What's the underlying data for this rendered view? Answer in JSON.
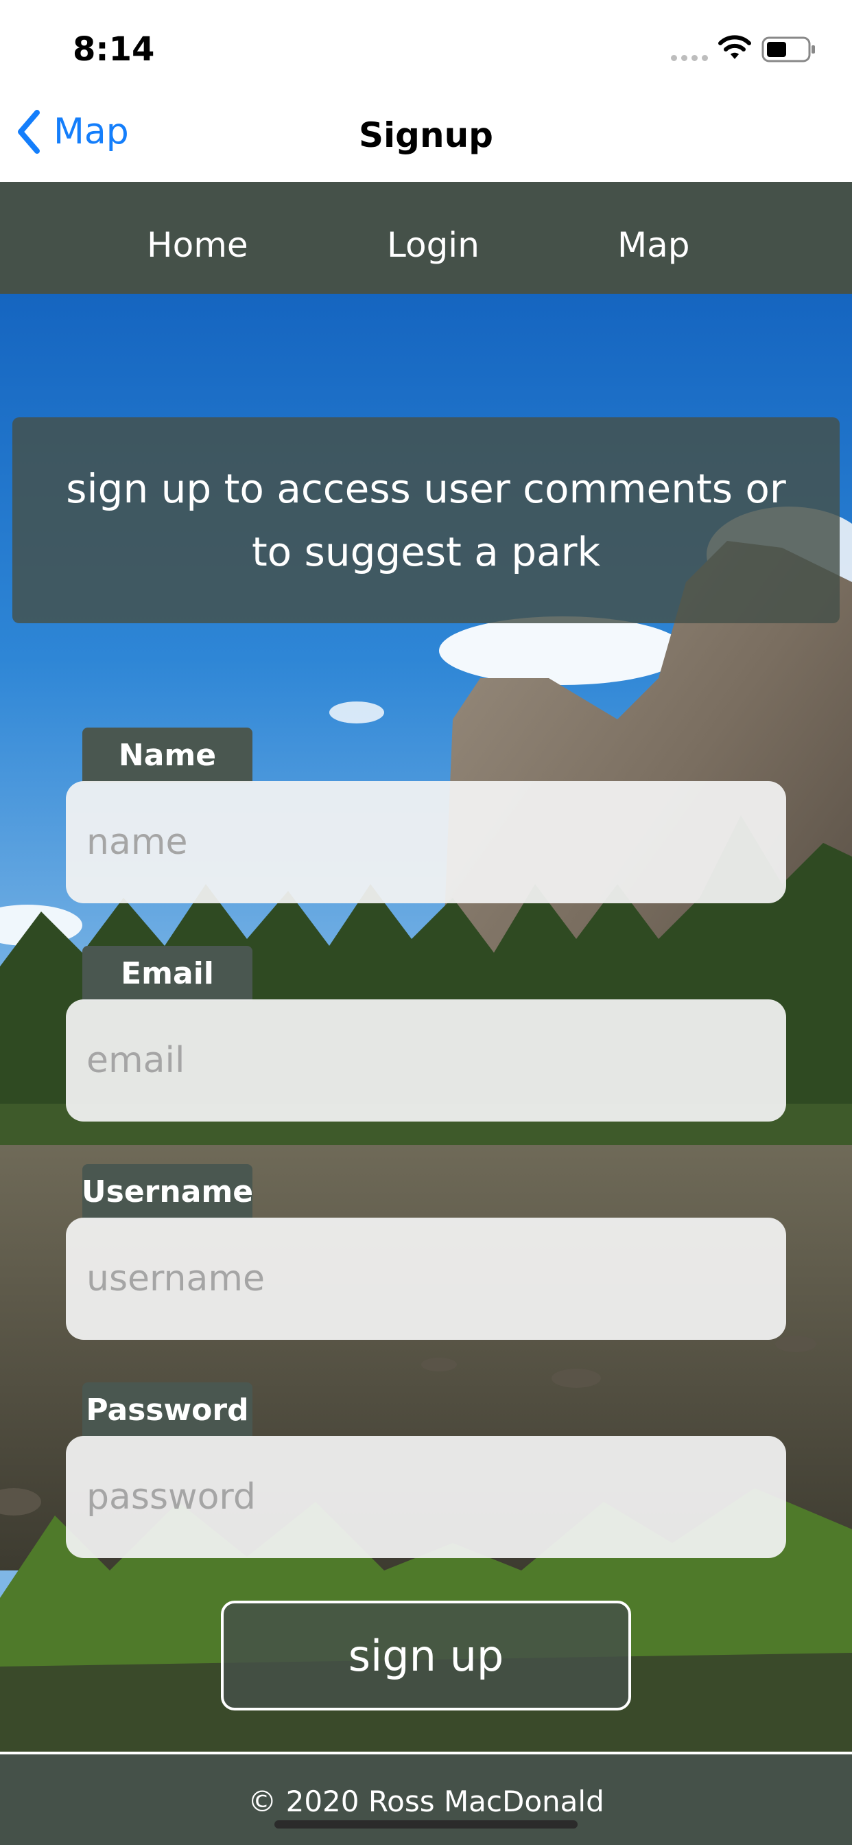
{
  "status_bar": {
    "time": "8:14"
  },
  "nav": {
    "back_label": "Map",
    "title": "Signup"
  },
  "menu": {
    "items": [
      "Home",
      "Login",
      "Map"
    ]
  },
  "banner": {
    "text": "sign up to access user comments or to suggest a park"
  },
  "form": {
    "fields": [
      {
        "label": "Name",
        "placeholder": "name",
        "value": ""
      },
      {
        "label": "Email",
        "placeholder": "email",
        "value": ""
      },
      {
        "label": "Username",
        "placeholder": "username",
        "value": ""
      },
      {
        "label": "Password",
        "placeholder": "password",
        "value": ""
      }
    ],
    "submit_label": "sign up"
  },
  "footer": {
    "copyright": "© 2020 Ross MacDonald"
  },
  "colors": {
    "accent": "#147efb",
    "menu_bg": "#455149",
    "label_bg": "#4a5750"
  },
  "icons": [
    "chevron-left-icon",
    "cellular-signal-icon",
    "wifi-icon",
    "battery-icon"
  ]
}
